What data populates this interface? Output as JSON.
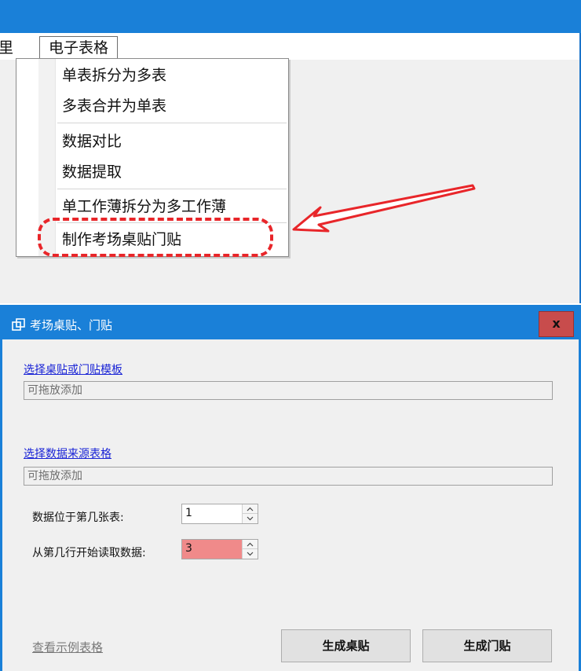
{
  "menubar": {
    "partial_item": "里",
    "active_menu": "电子表格"
  },
  "dropdown": {
    "items": [
      {
        "label": "单表拆分为多表"
      },
      {
        "label": "多表合并为单表"
      },
      {
        "label": "数据对比"
      },
      {
        "label": "数据提取"
      },
      {
        "label": "单工作薄拆分为多工作薄"
      },
      {
        "label": "制作考场桌贴门贴"
      }
    ]
  },
  "annotation": {
    "highlight_color": "#e8262a"
  },
  "dialog": {
    "title": "考场桌贴、门贴",
    "close_label": "x",
    "template_link": "选择桌贴或门贴模板",
    "template_placeholder": "可拖放添加",
    "source_link": "选择数据来源表格",
    "source_placeholder": "可拖放添加",
    "sheet_label": "数据位于第几张表:",
    "sheet_value": "1",
    "row_label": "从第几行开始读取数据:",
    "row_value": "3",
    "example_link": "查看示例表格",
    "desk_button": "生成桌贴",
    "door_button": "生成门贴"
  },
  "colors": {
    "titlebar": "#1a80d8",
    "close_button": "#c84c4c",
    "row_field_highlight": "#f08a8a",
    "link": "#1a24d6"
  }
}
